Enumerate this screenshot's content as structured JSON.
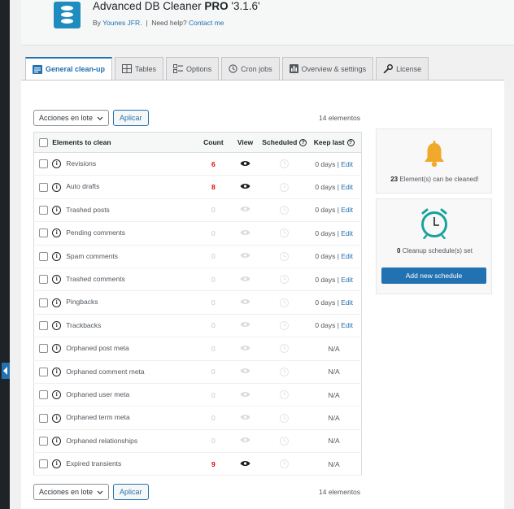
{
  "header": {
    "title": "Advanced DB Cleaner",
    "edition": "PRO",
    "version": "'3.1.6'",
    "by_prefix": "By",
    "author": "Younes JFR.",
    "separator": "|",
    "help_prefix": "Need help?",
    "help_link": "Contact me"
  },
  "tabs": [
    {
      "label": "General clean-up",
      "icon": "clean-icon",
      "active": true
    },
    {
      "label": "Tables",
      "icon": "table-icon",
      "active": false
    },
    {
      "label": "Options",
      "icon": "options-icon",
      "active": false
    },
    {
      "label": "Cron jobs",
      "icon": "clock-icon",
      "active": false
    },
    {
      "label": "Overview & settings",
      "icon": "overview-icon",
      "active": false
    },
    {
      "label": "License",
      "icon": "key-icon",
      "active": false
    }
  ],
  "bulk": {
    "select_label": "Acciones en lote",
    "apply_label": "Aplicar",
    "count_text": "14 elementos"
  },
  "table": {
    "headers": {
      "name": "Elements to clean",
      "count": "Count",
      "view": "View",
      "scheduled": "Scheduled",
      "keep_last": "Keep last"
    },
    "rows": [
      {
        "name": "Revisions",
        "count": "6",
        "viewable": true,
        "keep": "0 days",
        "edit": "Edit"
      },
      {
        "name": "Auto drafts",
        "count": "8",
        "viewable": true,
        "keep": "0 days",
        "edit": "Edit"
      },
      {
        "name": "Trashed posts",
        "count": "0",
        "viewable": false,
        "keep": "0 days",
        "edit": "Edit"
      },
      {
        "name": "Pending comments",
        "count": "0",
        "viewable": false,
        "keep": "0 days",
        "edit": "Edit"
      },
      {
        "name": "Spam comments",
        "count": "0",
        "viewable": false,
        "keep": "0 days",
        "edit": "Edit"
      },
      {
        "name": "Trashed comments",
        "count": "0",
        "viewable": false,
        "keep": "0 days",
        "edit": "Edit"
      },
      {
        "name": "Pingbacks",
        "count": "0",
        "viewable": false,
        "keep": "0 days",
        "edit": "Edit"
      },
      {
        "name": "Trackbacks",
        "count": "0",
        "viewable": false,
        "keep": "0 days",
        "edit": "Edit"
      },
      {
        "name": "Orphaned post meta",
        "count": "0",
        "viewable": false,
        "keep": "N/A",
        "edit": ""
      },
      {
        "name": "Orphaned comment meta",
        "count": "0",
        "viewable": false,
        "keep": "N/A",
        "edit": ""
      },
      {
        "name": "Orphaned user meta",
        "count": "0",
        "viewable": false,
        "keep": "N/A",
        "edit": ""
      },
      {
        "name": "Orphaned term meta",
        "count": "0",
        "viewable": false,
        "keep": "N/A",
        "edit": ""
      },
      {
        "name": "Orphaned relationships",
        "count": "0",
        "viewable": false,
        "keep": "N/A",
        "edit": ""
      },
      {
        "name": "Expired transients",
        "count": "9",
        "viewable": true,
        "keep": "N/A",
        "edit": ""
      }
    ]
  },
  "sidebar": {
    "cleanable_count": "23",
    "cleanable_text": "Element(s) can be cleaned!",
    "schedule_count": "0",
    "schedule_text": "Cleanup schedule(s) set",
    "add_schedule_label": "Add new schedule",
    "bell_color": "#f0a92b",
    "clock_color": "#19a29c"
  },
  "colors": {
    "accent": "#2271b1",
    "count_highlight": "#e30000"
  }
}
